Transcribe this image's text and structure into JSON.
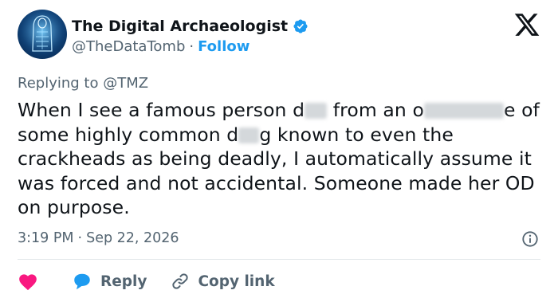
{
  "author": {
    "name": "The Digital Archaeologist",
    "handle": "@TheDataTomb",
    "separator": "·",
    "follow_label": "Follow",
    "verified_color": "#1d9bf0"
  },
  "reply_context": {
    "prefix": "Replying to",
    "mention": "@TMZ"
  },
  "tweet": {
    "segments": [
      "When I see a famous person d",
      " from an o",
      "e of some highly common d",
      "g known to even the crackheads as being deadly, I automatically assume it was forced and not accidental. Someone made her OD on purpose."
    ]
  },
  "meta": {
    "time": "3:19 PM",
    "separator": "·",
    "date": "Sep 22, 2026"
  },
  "actions": {
    "reply_label": "Reply",
    "copy_link_label": "Copy link"
  },
  "icons": {
    "logo": "x-logo-icon",
    "verified": "verified-badge-icon",
    "info": "info-icon",
    "like": "heart-icon",
    "reply": "reply-bubble-icon",
    "copy": "link-icon"
  },
  "colors": {
    "accent": "#1d9bf0",
    "like": "#f91880",
    "text": "#0f1419",
    "muted": "#536471"
  }
}
